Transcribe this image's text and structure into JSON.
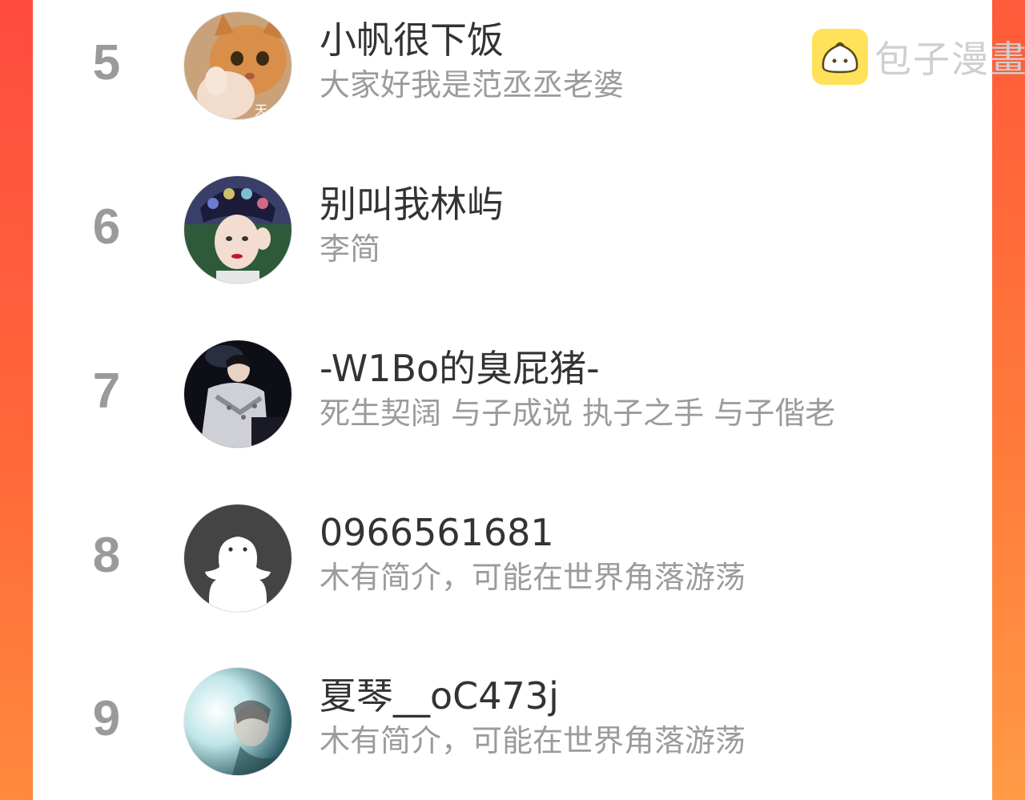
{
  "watermark": {
    "text": "包子漫畫",
    "icon": "baozi-logo-icon"
  },
  "rows": [
    {
      "rank": "5",
      "name": "小帆很下饭",
      "bio": "大家好我是范丞丞老婆",
      "avatar": "cat-photo-avatar"
    },
    {
      "rank": "6",
      "name": "别叫我林屿",
      "bio": "李简",
      "avatar": "portrait-headdress-avatar"
    },
    {
      "rank": "7",
      "name": "-W1Bo的臭屁猪-",
      "bio": "死生契阔 与子成说 执子之手 与子偕老",
      "avatar": "stage-performer-avatar"
    },
    {
      "rank": "8",
      "name": "0966561681",
      "bio": "木有简介，可能在世界角落游荡",
      "avatar": "default-ghost-avatar"
    },
    {
      "rank": "9",
      "name": "夏琴__oC473j",
      "bio": "木有简介，可能在世界角落游荡",
      "avatar": "soft-light-portrait-avatar"
    }
  ],
  "colors": {
    "background_left": "#ff4b3e",
    "background_right": "#ff7a3a",
    "rank": "#9a9a9a",
    "name": "#333333",
    "bio": "#9b9b9b",
    "watermark_icon": "#ffe15a"
  }
}
